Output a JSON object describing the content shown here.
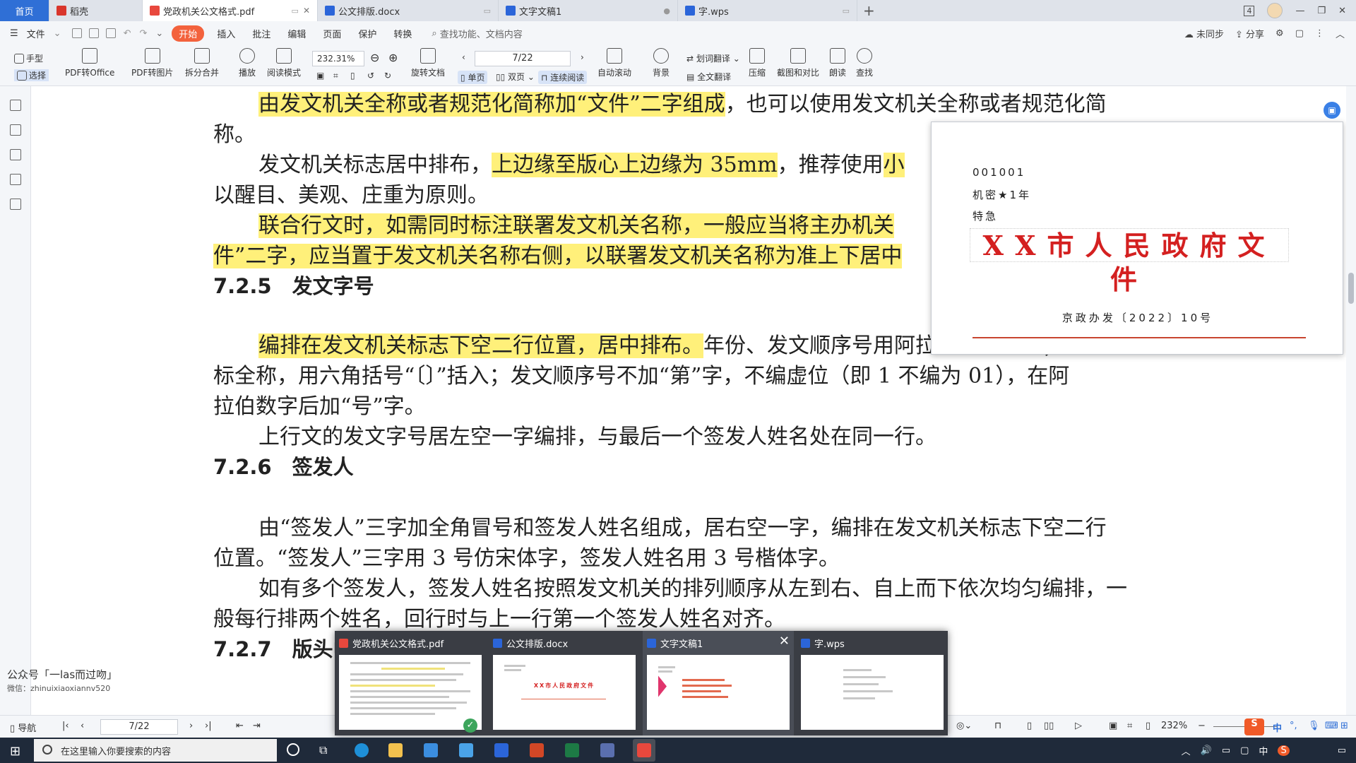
{
  "tabs": [
    {
      "label": "首页",
      "type": "home"
    },
    {
      "label": "稻壳",
      "icon": "wps"
    },
    {
      "label": "党政机关公文格式.pdf",
      "icon": "pdf",
      "active": true
    },
    {
      "label": "公文排版.docx",
      "icon": "doc"
    },
    {
      "label": "文字文稿1",
      "icon": "doc"
    },
    {
      "label": "字.wps",
      "icon": "doc"
    }
  ],
  "window": {
    "badge": "4"
  },
  "menu": {
    "file": "文件",
    "items": [
      "开始",
      "插入",
      "批注",
      "编辑",
      "页面",
      "保护",
      "转换"
    ],
    "search": "查找功能、文档内容",
    "right": [
      "未同步",
      "分享"
    ]
  },
  "toolbar": {
    "hand": "手型",
    "select": "选择",
    "pdf2office": "PDF转Office",
    "pdf2img": "PDF转图片",
    "split": "拆分合并",
    "play": "播放",
    "readmode": "阅读模式",
    "zoom": "232.31%",
    "rotate": "旋转文档",
    "page": "7/22",
    "single": "单页",
    "double": "双页",
    "continuous": "连续阅读",
    "autoscroll": "自动滚动",
    "background": "背景",
    "wordtrans": "划词翻译",
    "fulltrans": "全文翻译",
    "compress": "压缩",
    "compare": "截图和对比",
    "read": "朗读",
    "find": "查找"
  },
  "doc": {
    "l1a": "由发文机关全称或者规范化简称加“文件”二字组成",
    "l1b": "，也可以使用发文机关全称或者规范化简",
    "l2": "称。",
    "l3a": "发文机关标志居中排布，",
    "l3b": "上边缘至版心上边缘为 35mm",
    "l3c": "，推荐使用",
    "l3d": "小",
    "l4": "以醒目、美观、庄重为原则。",
    "l5": "联合行文时，如需同时标注联署发文机关名称，一般应当将主办机关",
    "l6": "件”二字，应当置于发文机关名称右侧，以联署发文机关名称为准上下居中",
    "h1": "7.2.5　发文字号",
    "l8a": "编排在发文机关标志下空二行位置，居中排布。",
    "l8b": "年份、发文顺序号用阿拉伯数字标注；年份应",
    "l9": "标全称，用六角括号“〔〕”括入；发文顺序号不加“第”字，不编虚位（即 1 不编为 01），在阿",
    "l10": "拉伯数字后加“号”字。",
    "l11": "上行文的发文字号居左空一字编排，与最后一个签发人姓名处在同一行。",
    "h2": "7.2.6　签发人",
    "l13": "由“签发人”三字加全角冒号和签发人姓名组成，居右空一字，编排在发文机关标志下空二行",
    "l14": "位置。“签发人”三字用 3 号仿宋体字，签发人姓名用 3 号楷体字。",
    "l15": "如有多个签发人，签发人姓名按照发文机关的排列顺序从左到右、自上而下依次均匀编排，一",
    "l16": "般每行排两个姓名，回行时与上一行第一个签发人姓名对齐。",
    "h3": "7.2.7　版头中"
  },
  "popup": {
    "code": "001001",
    "secret": "机密★1年",
    "urgent": "特急",
    "title": "XX市人民政府文件",
    "docno": "京政办发〔2022〕10号"
  },
  "statusbar": {
    "nav": "导航",
    "page": "7/22",
    "zoom": "232%"
  },
  "taskbar": {
    "search": "在这里输入你要搜索的内容",
    "ime": "中",
    "ime2": "中"
  },
  "thumbs": [
    {
      "label": "党政机关公文格式.pdf",
      "icon": "pdf"
    },
    {
      "label": "公文排版.docx",
      "icon": "doc",
      "title": "XX市人民政府文件"
    },
    {
      "label": "文字文稿1",
      "icon": "doc"
    },
    {
      "label": "字.wps",
      "icon": "doc"
    }
  ],
  "watermark": {
    "line1": "公众号「一las而过吻」",
    "line2": "微信：zhinuixiaoxiannv520"
  },
  "colors": {
    "accent": "#2f6fd6",
    "start": "#f3623d",
    "highlight": "#fff07a",
    "red": "#d42020"
  }
}
